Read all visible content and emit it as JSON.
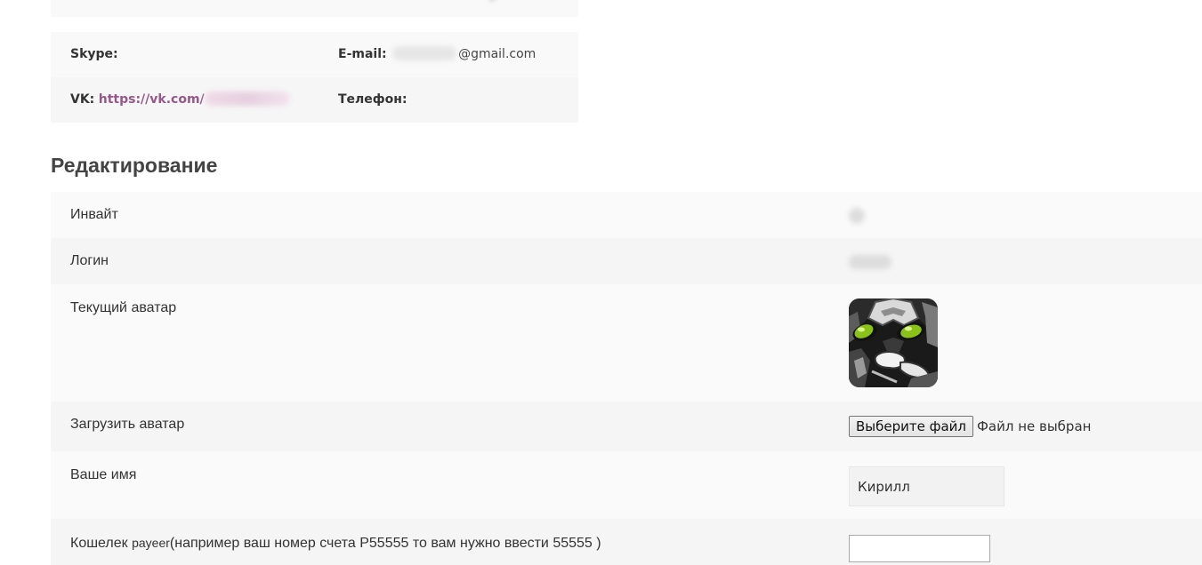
{
  "contact": {
    "skype_label": "Skype:",
    "email_label": "E-mail:",
    "email_suffix": "@gmail.com",
    "vk_label": "VK:",
    "vk_link": "https://vk.com/",
    "phone_label": "Телефон:"
  },
  "edit": {
    "title": "Редактирование",
    "invite_label": "Инвайт",
    "login_label": "Логин",
    "current_avatar_label": "Текущий аватар",
    "upload_avatar_label": "Загрузить аватар",
    "choose_file_button": "Выберите файл",
    "file_status": "Файл не выбран",
    "your_name_label": "Ваше имя",
    "your_name_value": "Кирилл",
    "wallet_label_prefix": "Кошелек ",
    "wallet_label_small": "payeer",
    "wallet_label_suffix": "(например ваш номер счета P55555 то вам нужно ввести 55555 )",
    "wallet_value": ""
  },
  "colors": {
    "link": "#96588a",
    "row_bg": "#fafafa",
    "heading": "#444444"
  }
}
